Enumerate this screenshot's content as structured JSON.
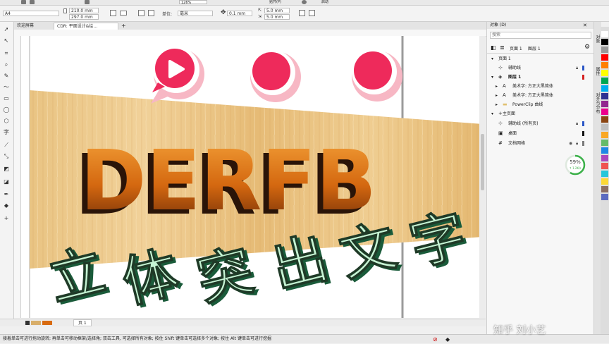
{
  "title_bar": {
    "zoom": "126%",
    "snap_label": "贴齐(P)",
    "launch_label": "启动"
  },
  "propbar": {
    "page_size": "A4",
    "width": "210.0 mm",
    "height": "297.0 mm",
    "units_label": "单位:",
    "units_value": "毫米",
    "nudge": "0.1 mm",
    "dup_x": "5.0 mm",
    "dup_y": "5.0 mm"
  },
  "tabs": [
    {
      "label": "欢迎屏幕"
    },
    {
      "label": "CDR: 平面设计&绘..."
    }
  ],
  "canvas": {
    "logo_text": "DERFB",
    "title_chars": [
      "立",
      "体",
      "突",
      "出",
      "文",
      "字"
    ],
    "colors": {
      "pink_circle": "#ee2a5b",
      "glow_green": "#c6f4d4",
      "wood": "#ebc27f",
      "letter_dark": "#2a1408",
      "letter_orange": "#d86b10"
    }
  },
  "page_tab": {
    "label": "页 1"
  },
  "status": {
    "text": "接着单击可进行拖动旋转; 再单击可移动框架/选择角; 双击工具, 可选择所有对象; 按住 Shift 键单击可选择多个对象; 按住 Alt 键单击可进行挖掘"
  },
  "panel": {
    "header": "对象 (D)",
    "search_placeholder": "搜索",
    "current_page": "页面 1",
    "current_layer": "图层 1",
    "tree": [
      {
        "label": "页面 1",
        "level": 0,
        "arrow": "▾",
        "icon": ""
      },
      {
        "label": "辅助线",
        "level": 1,
        "arrow": "",
        "icon": "⊹"
      },
      {
        "label": "图层 1",
        "level": 1,
        "arrow": "▾",
        "icon": "◈"
      },
      {
        "label": "美术字: 方正大黑简体",
        "level": 2,
        "arrow": "▸",
        "icon": "A"
      },
      {
        "label": "美术字: 方正大黑简体",
        "level": 2,
        "arrow": "▸",
        "icon": "A"
      },
      {
        "label": "PowerClip 曲线",
        "level": 2,
        "arrow": "▸",
        "icon": "▬"
      },
      {
        "label": "主页面",
        "level": 0,
        "arrow": "▾",
        "icon": "+"
      },
      {
        "label": "辅助线 (所有页)",
        "level": 1,
        "arrow": "",
        "icon": "⊹"
      },
      {
        "label": "桌面",
        "level": 1,
        "arrow": "",
        "icon": "▣"
      },
      {
        "label": "文档网格",
        "level": 1,
        "arrow": "",
        "icon": "#"
      }
    ],
    "perf_percent": "59%",
    "perf_speed": "↑ 1.2K/s"
  },
  "dockers": [
    {
      "label": "对象"
    },
    {
      "label": "属性"
    },
    {
      "label": "对齐与分布"
    }
  ],
  "watermark": "知乎 刘小艺"
}
